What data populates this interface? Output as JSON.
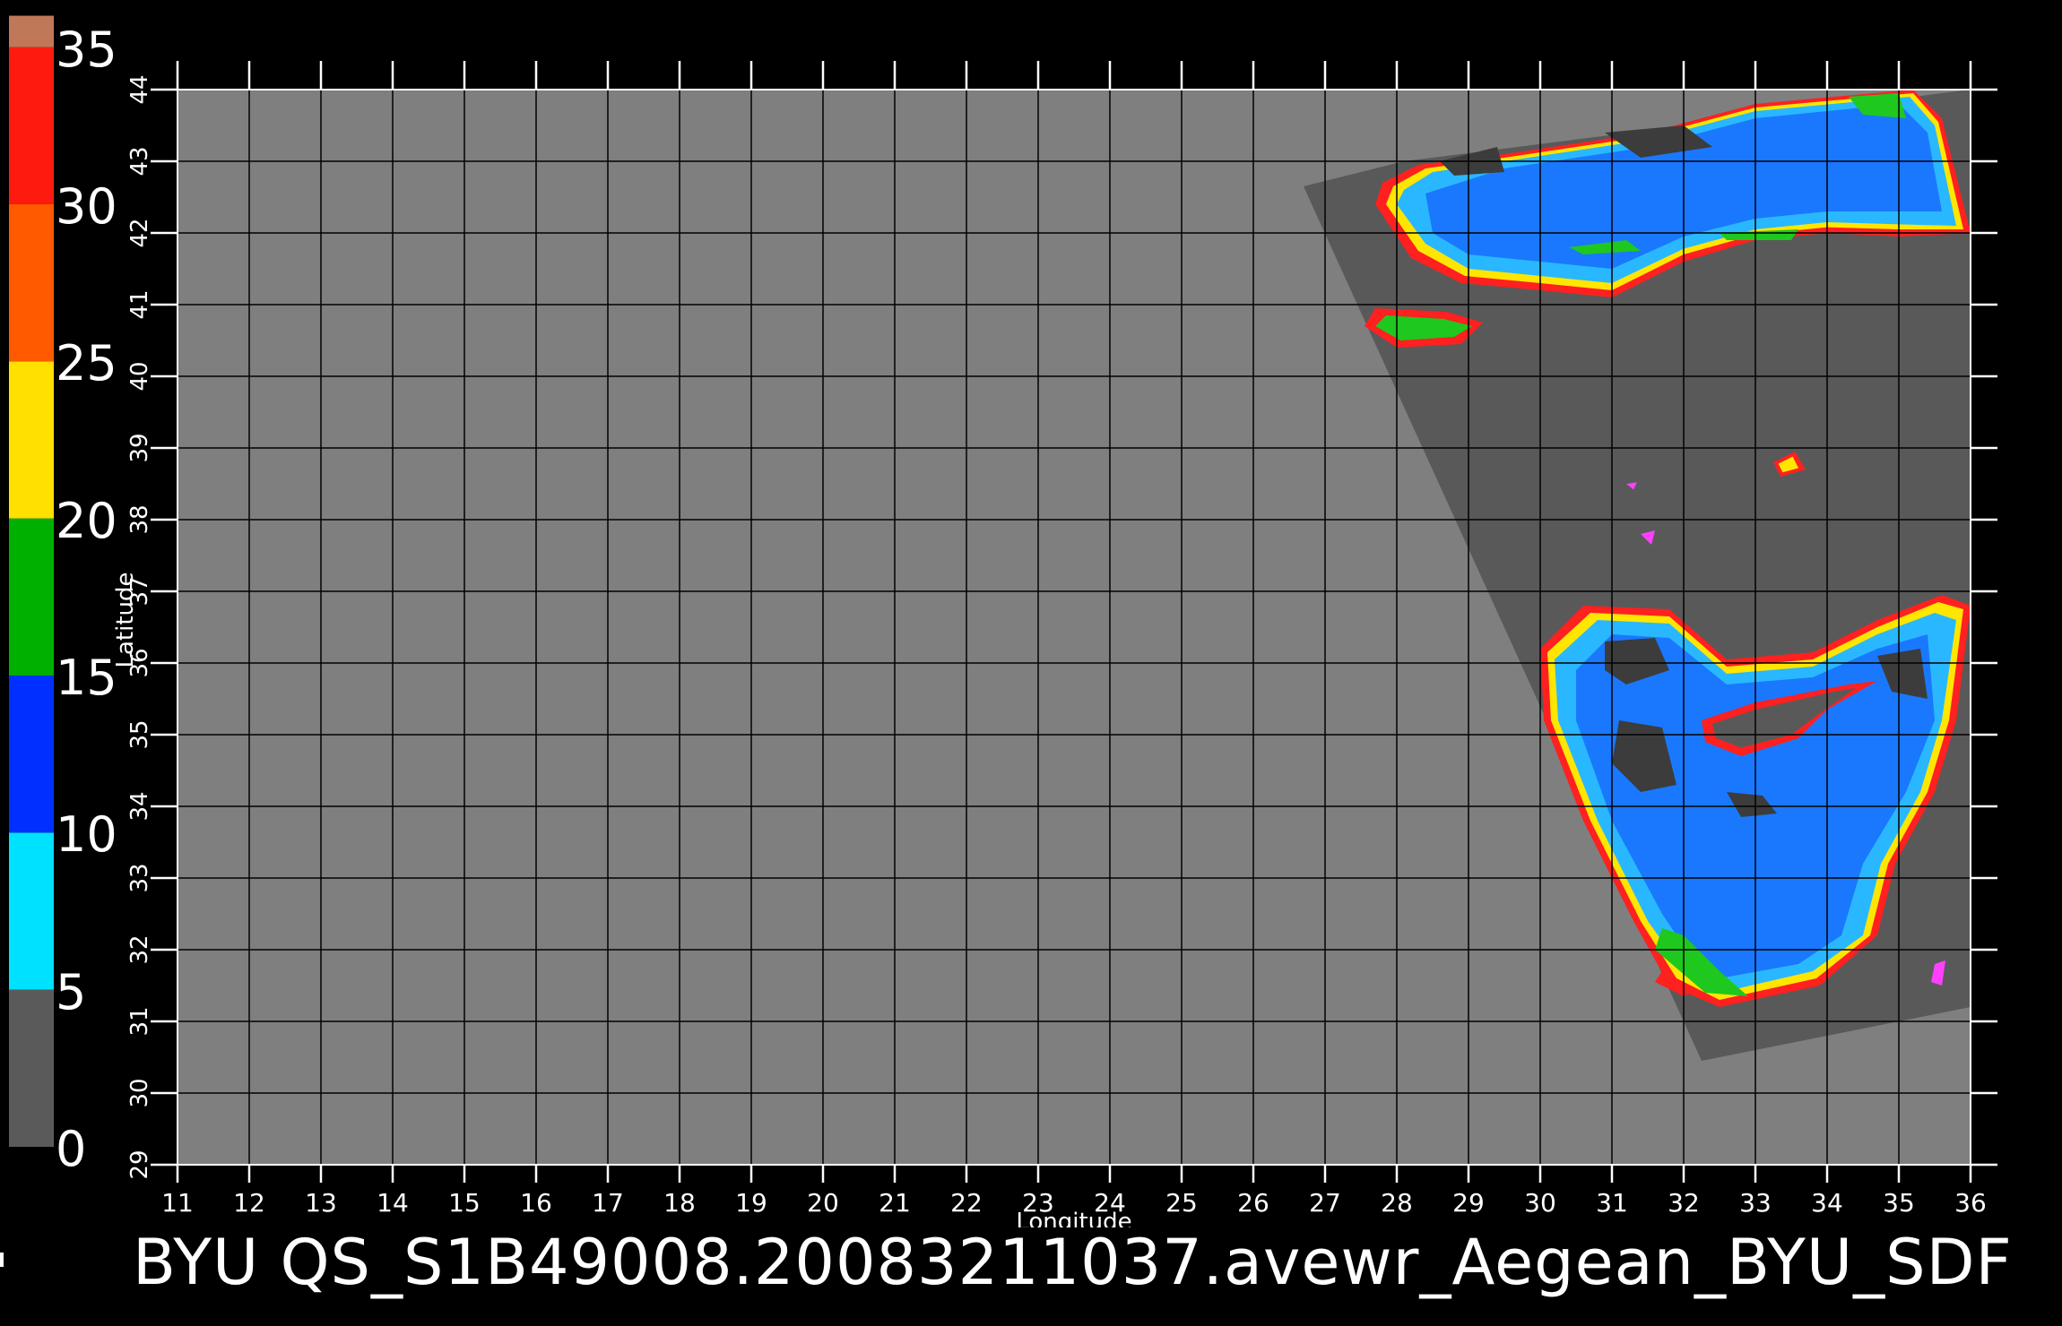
{
  "colorbar": {
    "labels": [
      "35",
      "30",
      "25",
      "20",
      "15",
      "10",
      "5",
      "0"
    ],
    "bands": [
      {
        "from": 0,
        "to": 5,
        "color": "#5a5a5a"
      },
      {
        "from": 5,
        "to": 10,
        "color": "#00e0ff"
      },
      {
        "from": 10,
        "to": 15,
        "color": "#0030ff"
      },
      {
        "from": 15,
        "to": 20,
        "color": "#00b000"
      },
      {
        "from": 20,
        "to": 25,
        "color": "#ffe000"
      },
      {
        "from": 25,
        "to": 30,
        "color": "#ff5a00"
      },
      {
        "from": 30,
        "to": 35,
        "color": "#ff1a10"
      },
      {
        "from": 35,
        "to": 36,
        "color": "#c07858"
      }
    ]
  },
  "map": {
    "xlabel": "Longitude",
    "ylabel": "Latitude",
    "lon_range": [
      11,
      36
    ],
    "lat_range": [
      29,
      44
    ],
    "lon_ticks": [
      "11",
      "12",
      "13",
      "14",
      "15",
      "16",
      "17",
      "18",
      "19",
      "20",
      "21",
      "22",
      "23",
      "24",
      "25",
      "26",
      "27",
      "28",
      "29",
      "30",
      "31",
      "32",
      "33",
      "34",
      "35",
      "36"
    ],
    "lat_ticks": [
      "29",
      "30",
      "31",
      "32",
      "33",
      "34",
      "35",
      "36",
      "37",
      "38",
      "39",
      "40",
      "41",
      "42",
      "43",
      "44"
    ],
    "colors": {
      "background": "#7f7f7f",
      "swath": "#595959",
      "grid": "#000000",
      "sea_blue": "#1a78ff",
      "sea_light": "#29b8ff",
      "coast_green": "#1ec81e",
      "coast_yellow": "#ffe600",
      "coast_red": "#ff2020",
      "coast_magenta": "#ff40ff",
      "dark_patch": "#3c3c3c"
    }
  },
  "caption": "BYU  QS_S1B49008.20083211037.avewr_Aegean_BYU_SDF"
}
